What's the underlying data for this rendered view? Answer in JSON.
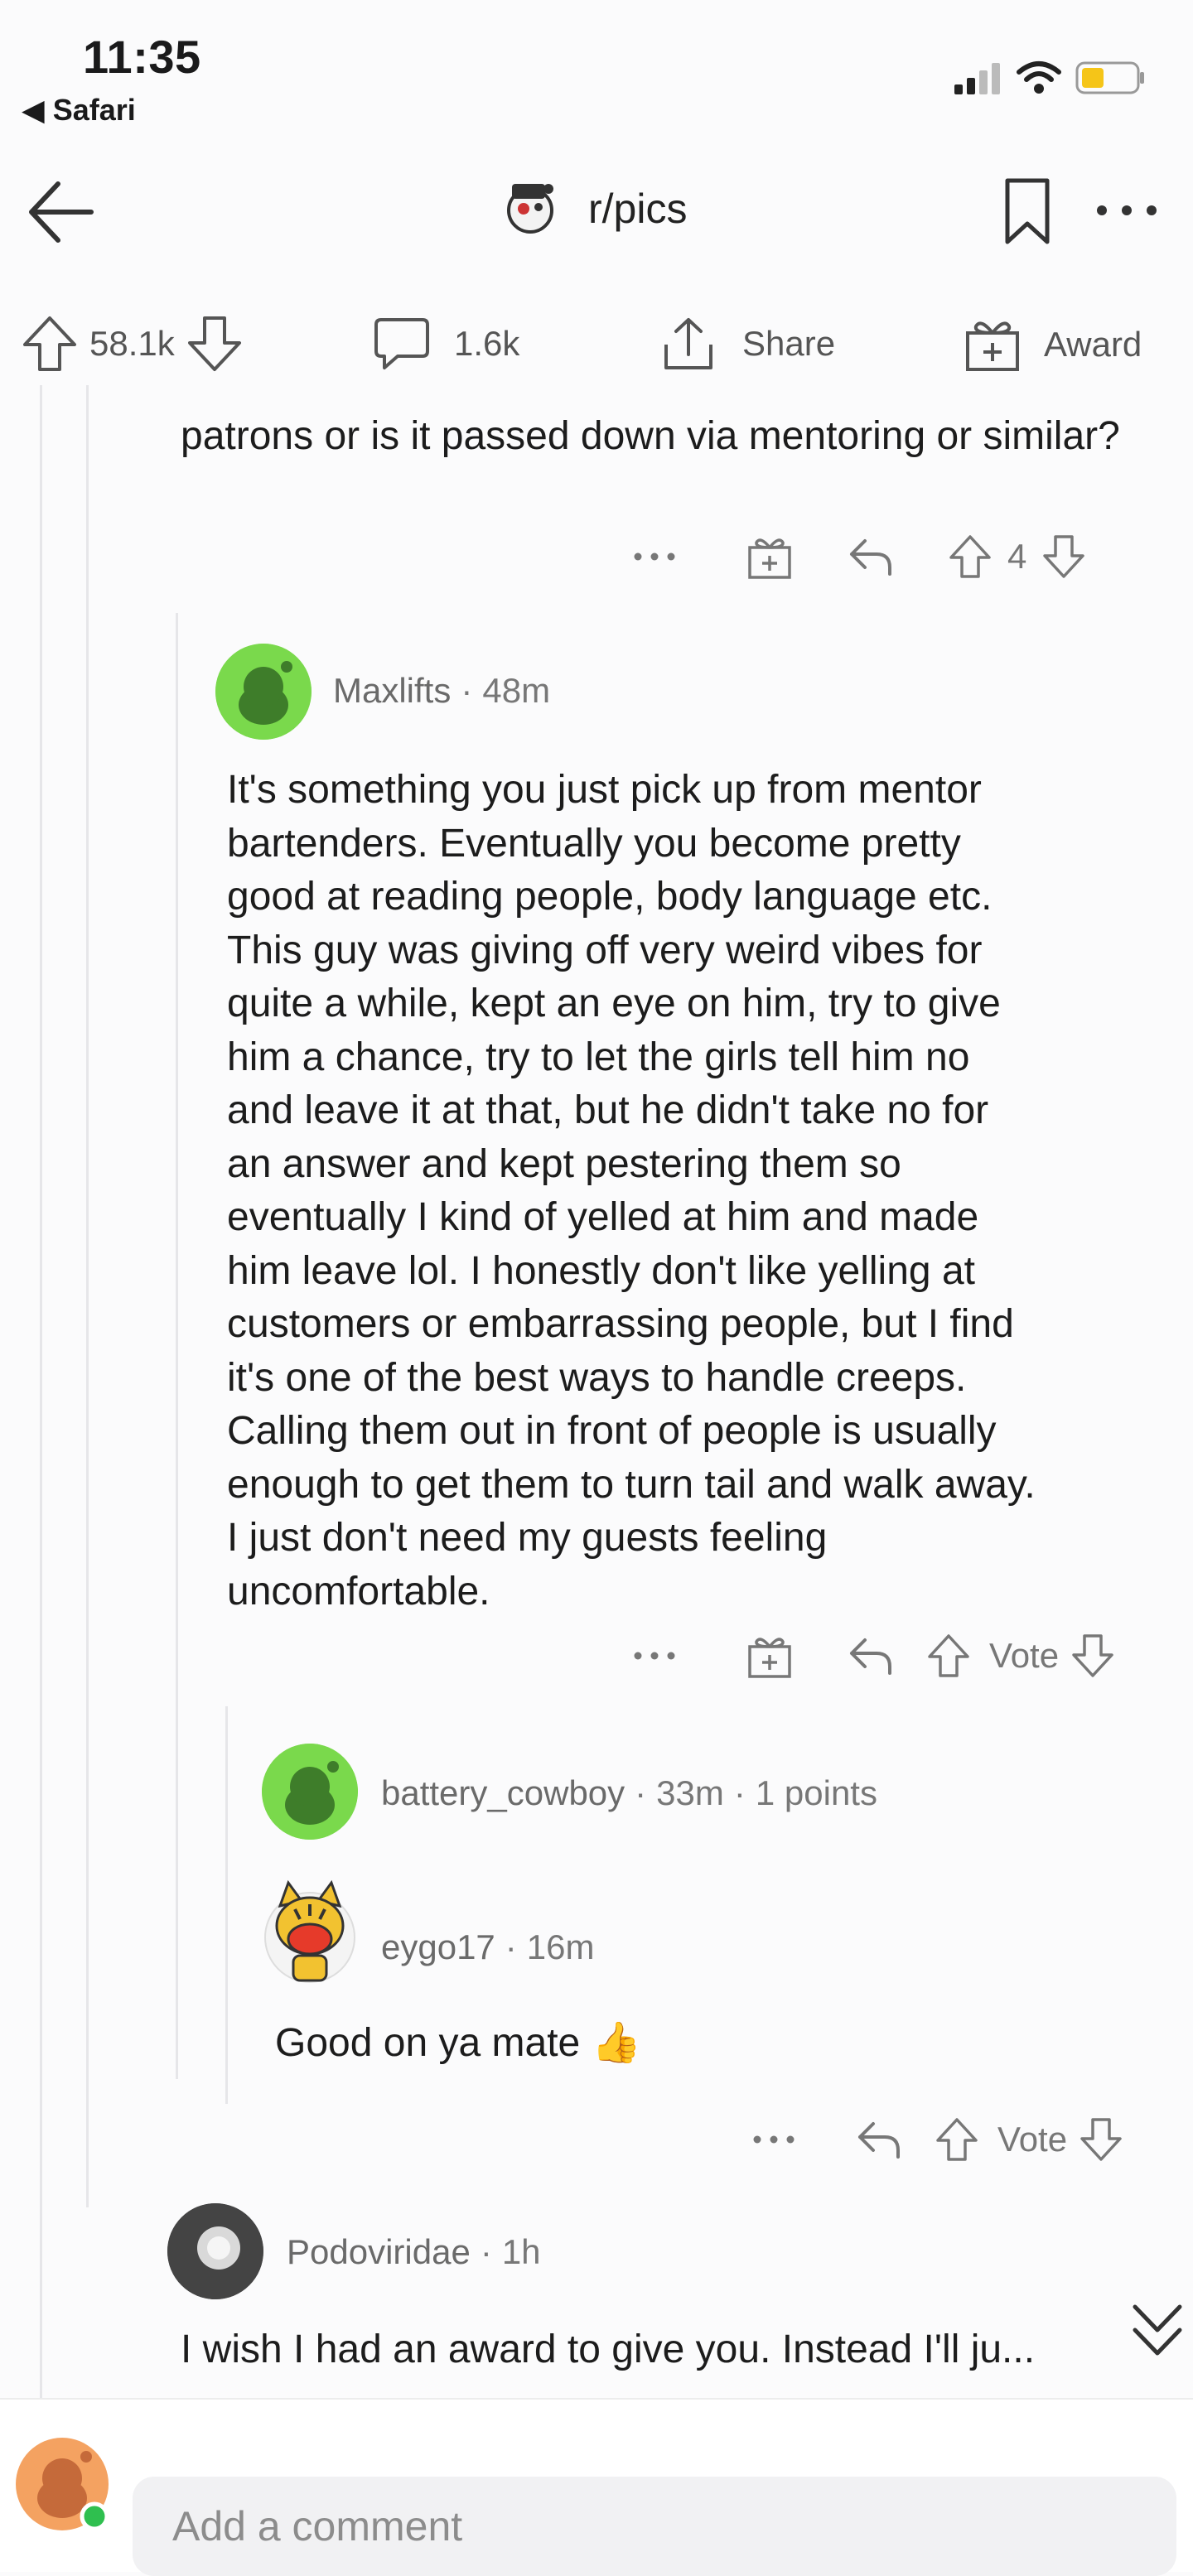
{
  "status_bar": {
    "time": "11:35",
    "back_app": "Safari"
  },
  "nav": {
    "subreddit": "r/pics"
  },
  "action_bar": {
    "upvotes": "58.1k",
    "comments": "1.6k",
    "share": "Share",
    "award": "Award"
  },
  "comments": {
    "parent": {
      "text_partial": "patrons or is it passed down via mentoring or similar?",
      "score": "4"
    },
    "maxlifts": {
      "user": "Maxlifts",
      "time": "48m",
      "lines": [
        "It's something you just pick up from mentor",
        "bartenders. Eventually you become pretty",
        "good at reading people, body language etc.",
        "This guy was giving off very weird vibes for",
        "quite a while, kept an eye on him, try to give",
        "him a chance, try to let the girls tell him no",
        "and leave it at that, but he didn't take no for",
        "an answer and kept pestering them so",
        "eventually I kind of yelled at him and made",
        "him leave lol. I honestly don't like yelling at",
        "customers or embarrassing people, but I find",
        "it's one of the best ways to handle creeps.",
        "Calling them out in front of people is usually",
        "enough to get them to turn tail and walk away.",
        "I just don't need my guests feeling",
        "uncomfortable."
      ],
      "vote_label": "Vote"
    },
    "battery_cowboy": {
      "user": "battery_cowboy",
      "time": "33m",
      "points": "1 points"
    },
    "eygo17": {
      "user": "eygo17",
      "time": "16m",
      "text": "Good on ya mate",
      "emoji": "👍",
      "vote_label": "Vote"
    },
    "podoviridae": {
      "user": "Podoviridae",
      "time": "1h",
      "text": "I wish I had an award to give you. Instead I'll ju..."
    }
  },
  "bottom": {
    "comment_placeholder": "Add a comment"
  },
  "icons": [
    "back-arrow-icon",
    "bookmark-icon",
    "more-icon",
    "upvote-icon",
    "downvote-icon",
    "comment-icon",
    "share-icon",
    "award-icon",
    "reply-icon",
    "chevron-down-icon"
  ],
  "colors": {
    "snoo_green": "#7ad94c",
    "battery_yellow": "#f5c518",
    "online_green": "#2fbf4f"
  }
}
